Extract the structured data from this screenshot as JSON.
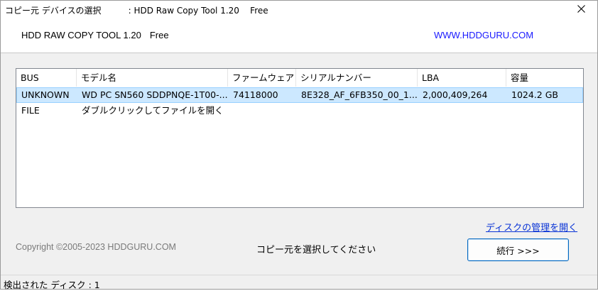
{
  "window": {
    "title": "コピー元 デバイスの選択          : HDD Raw Copy Tool 1.20    Free"
  },
  "header": {
    "app_name": "HDD RAW COPY TOOL 1.20",
    "edition": "Free",
    "website": "WWW.HDDGURU.COM"
  },
  "device_list": {
    "columns": [
      "BUS",
      "モデル名",
      "ファームウェア",
      "シリアルナンバー",
      "LBA",
      "容量"
    ],
    "rows": [
      {
        "bus": "UNKNOWN",
        "model": "WD PC SN560 SDDPNQE-1T00-...",
        "firmware": "74118000",
        "serial": "8E328_AF_6FB350_00_1...",
        "lba": "2,000,409,264",
        "capacity": "1024.2 GB",
        "selected": true
      },
      {
        "bus": "FILE",
        "model": "ダブルクリックしてファイルを開く",
        "firmware": "",
        "serial": "",
        "lba": "",
        "capacity": "",
        "selected": false
      }
    ]
  },
  "manage_disk_link": "ディスクの管理を開く",
  "copyright": "Copyright ©2005-2023 HDDGURU.COM",
  "hint": "コピー元を選択してください",
  "continue_button": "続行 >>>",
  "status": {
    "detected_disks": "検出された ディスク : 1"
  },
  "colors": {
    "selection": "#cce8ff",
    "link": "#1a1aff",
    "button_border": "#0067c0"
  },
  "icons": {
    "close": "close-icon"
  }
}
